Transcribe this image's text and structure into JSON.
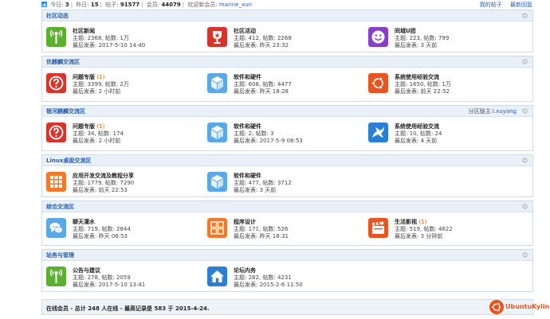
{
  "topbar": {
    "today_label": "今日:",
    "today": "3",
    "yesterday_label": "昨日:",
    "yesterday": "15",
    "posts_label": "帖子:",
    "posts": "91577",
    "members_label": "会员:",
    "members": "44079",
    "welcome_label": "欢迎新会员:",
    "newest_member": "marine_xun",
    "my_posts": "我的帖子",
    "latest_replies": "最新回复"
  },
  "sections": [
    {
      "title": "社区动态",
      "forums": [
        {
          "name": "社区新闻",
          "new": "",
          "stats": "主题: 2368, 帖数: 1万",
          "last": "最后发表: 2017-5-10 14:40",
          "icon": "antenna-icon",
          "color": "#5cb030"
        },
        {
          "name": "社区活动",
          "new": "",
          "stats": "主题: 412, 帖数: 2268",
          "last": "最后发表: 昨天 23:32",
          "icon": "trophy-icon",
          "color": "#d9342b"
        },
        {
          "name": "同城U团",
          "new": "",
          "stats": "主题: 223, 帖数: 799",
          "last": "最后发表: 3 天前",
          "icon": "smiley-icon",
          "color": "#8a3fc7"
        }
      ]
    },
    {
      "title": "优麒麟交流区",
      "forums": [
        {
          "name": "问题专版",
          "new": "(1)",
          "stats": "主题: 3399, 帖数: 2万",
          "last": "最后发表: 2 小时前",
          "icon": "question-icon",
          "color": "#d9342b"
        },
        {
          "name": "软件和硬件",
          "new": "",
          "stats": "主题: 608, 帖数: 4477",
          "last": "最后发表: 昨天 18:28",
          "icon": "cube-icon",
          "color": "#5aa9e6"
        },
        {
          "name": "系统使用经验交流",
          "new": "",
          "stats": "主题: 1650, 帖数: 1万",
          "last": "最后发表: 前天 22:52",
          "icon": "ubuntu-icon",
          "color": "#e95420"
        }
      ]
    },
    {
      "title": "银河麒麟交流区",
      "moderator_label": "分区版主:",
      "moderator": "l.xuyang",
      "forums": [
        {
          "name": "问题专版",
          "new": "(1)",
          "stats": "主题: 34, 帖数: 174",
          "last": "最后发表: 2 小时前",
          "icon": "question-icon",
          "color": "#d9342b"
        },
        {
          "name": "软件和硬件",
          "new": "",
          "stats": "主题: 2, 帖数: 3",
          "last": "最后发表: 2017-5-9 08:53",
          "icon": "cube-icon",
          "color": "#5aa9e6"
        },
        {
          "name": "系统使用经验交流",
          "new": "",
          "stats": "主题: 10, 帖数: 24",
          "last": "最后发表: 4 天前",
          "icon": "kylin-icon",
          "color": "#2a7fd4"
        }
      ]
    },
    {
      "title": "Linux桌面交流区",
      "forums": [
        {
          "name": "应用开发交流及教程分享",
          "new": "",
          "stats": "主题: 1779, 帖数: 7290",
          "last": "最后发表: 前天 22:53",
          "icon": "grid-icon",
          "color": "#f07a2a"
        },
        {
          "name": "软件和硬件",
          "new": "",
          "stats": "主题: 477, 帖数: 3712",
          "last": "最后发表: 3 天前",
          "icon": "cube-icon",
          "color": "#5aa9e6"
        }
      ]
    },
    {
      "title": "综合交流区",
      "forums": [
        {
          "name": "聊天灌水",
          "new": "",
          "stats": "主题: 719, 帖数: 2844",
          "last": "最后发表: 昨天 06:53",
          "icon": "chat-icon",
          "color": "#5aa9e6"
        },
        {
          "name": "程序设计",
          "new": "",
          "stats": "主题: 171, 帖数: 526",
          "last": "最后发表: 昨天 18:31",
          "icon": "tiles-icon",
          "color": "#f07a2a"
        },
        {
          "name": "生活影视",
          "new": "(1)",
          "stats": "主题: 519, 帖数: 4622",
          "last": "最后发表: 3 分钟前",
          "icon": "film-icon",
          "color": "#e95420"
        }
      ]
    },
    {
      "title": "站务与管理",
      "forums": [
        {
          "name": "公告与建议",
          "new": "",
          "stats": "主题: 278, 帖数: 2059",
          "last": "最后发表: 2017-5-10 13:41",
          "icon": "antenna-icon",
          "color": "#5cb030"
        },
        {
          "name": "论坛内务",
          "new": "",
          "stats": "主题: 282, 帖数: 4231",
          "last": "最后发表: 2015-2-6 11:50",
          "icon": "home-icon",
          "color": "#2a7fd4"
        }
      ]
    }
  ],
  "footer": {
    "online_text": "在线会员 - 总计 248 人在线 - 最高记录是 583 于 2015-4-24.",
    "brand": "UbuntuKylin"
  }
}
